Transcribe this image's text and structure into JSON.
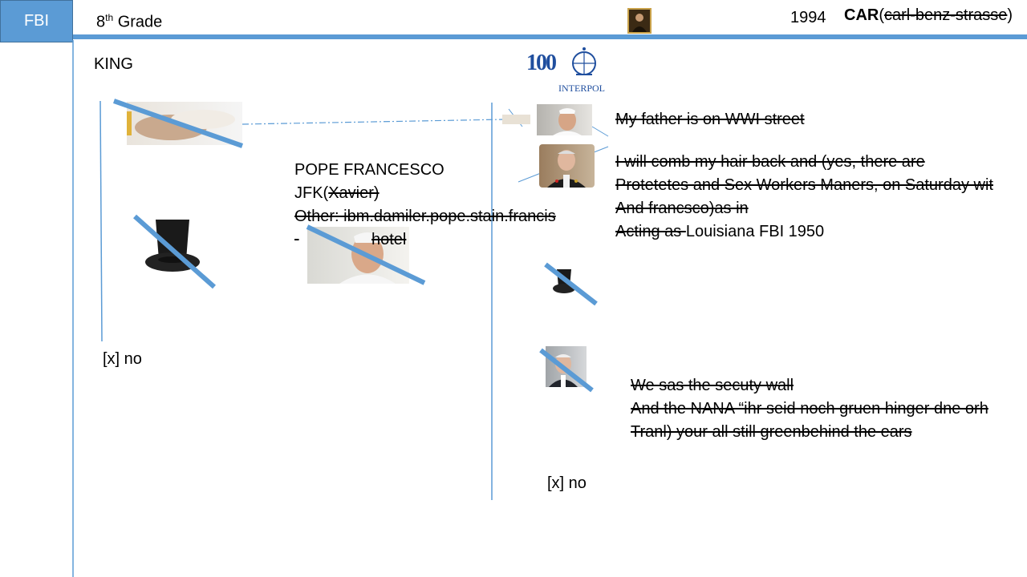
{
  "header": {
    "badge": "FBI",
    "grade_number": "8",
    "grade_suffix": "th",
    "grade_word": " Grade",
    "year": "1994",
    "car_label": "CAR",
    "car_paren_open": "(",
    "car_struck": "carl-benz-strasse",
    "car_paren_close": ")"
  },
  "left": {
    "king": "KING",
    "no_checkbox": "[x] no"
  },
  "logo": {
    "number": "100",
    "name": "INTERPOL"
  },
  "middle": {
    "pope": "POPE FRANCESCO",
    "jfk_prefix": "JFK(",
    "jfk_struck": "Xavier)",
    "other": "Other: ibm.damiler.pope.stain.francis",
    "hotel": "hotel"
  },
  "right": {
    "line1": "My father is on WWI street",
    "line2": "I will comb my hair back and (yes, there are",
    "line3": "Protetetes and Sex Workers Maners, on Saturday wit",
    "line4": "And francsco)as in ",
    "line5_struck": "Acting as ",
    "line5_plain": "Louisiana FBI 1950",
    "wall1": "We sas the secuty wall",
    "wall2": "And the NANA “ihr seid noch gruen hinger dne orh",
    "wall3": "Tranl) your all still greenbehind the ears",
    "no_checkbox": "[x] no"
  },
  "colors": {
    "accent": "#5b9bd5",
    "strike_bar": "#5b9bd5"
  }
}
